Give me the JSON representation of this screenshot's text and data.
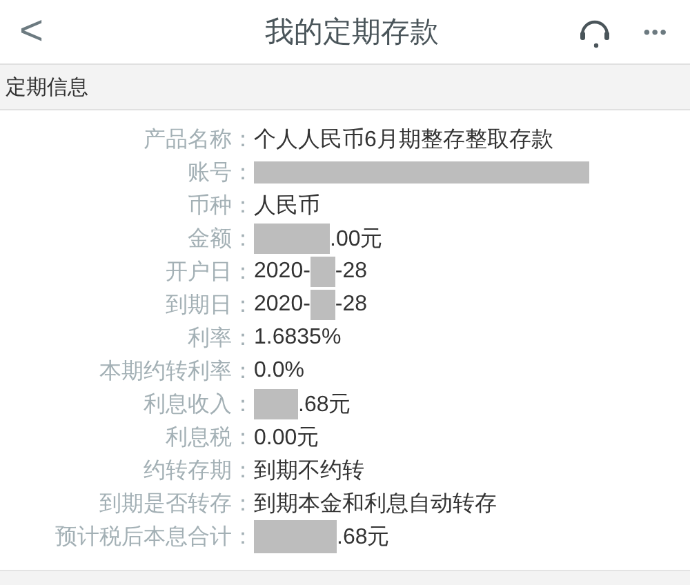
{
  "header": {
    "back": "<",
    "title": "我的定期存款",
    "more": "•••"
  },
  "section": {
    "title": "定期信息"
  },
  "rows": [
    {
      "label": "产品名称：",
      "segments": [
        {
          "kind": "text",
          "text": "个人人民币6月期整存整取存款"
        }
      ]
    },
    {
      "label": "账号：",
      "segments": [
        {
          "kind": "wideblank"
        }
      ]
    },
    {
      "label": "币种：",
      "segments": [
        {
          "kind": "text",
          "text": "人民币"
        }
      ]
    },
    {
      "label": "金额：",
      "segments": [
        {
          "kind": "blank"
        },
        {
          "kind": "text",
          "text": ".00元"
        }
      ]
    },
    {
      "label": "开户日：",
      "segments": [
        {
          "kind": "text",
          "text": "2020-"
        },
        {
          "kind": "narrowblank"
        },
        {
          "kind": "text",
          "text": "-28"
        }
      ]
    },
    {
      "label": "到期日：",
      "segments": [
        {
          "kind": "text",
          "text": "2020-"
        },
        {
          "kind": "narrowblank"
        },
        {
          "kind": "text",
          "text": "-28"
        }
      ]
    },
    {
      "label": "利率：",
      "segments": [
        {
          "kind": "text",
          "text": "1.6835%"
        }
      ]
    },
    {
      "label": "本期约转利率：",
      "segments": [
        {
          "kind": "text",
          "text": "0.0%"
        }
      ]
    },
    {
      "label": "利息收入：",
      "segments": [
        {
          "kind": "shortblank"
        },
        {
          "kind": "text",
          "text": ".68元"
        }
      ]
    },
    {
      "label": "利息税：",
      "segments": [
        {
          "kind": "text",
          "text": "0.00元"
        }
      ]
    },
    {
      "label": "约转存期：",
      "segments": [
        {
          "kind": "text",
          "text": "到期不约转"
        }
      ]
    },
    {
      "label": "到期是否转存：",
      "segments": [
        {
          "kind": "text",
          "text": "到期本金和利息自动转存"
        }
      ]
    },
    {
      "label": "预计税后本息合计：",
      "segments": [
        {
          "kind": "longblank"
        },
        {
          "kind": "text",
          "text": ".68元"
        }
      ]
    }
  ]
}
